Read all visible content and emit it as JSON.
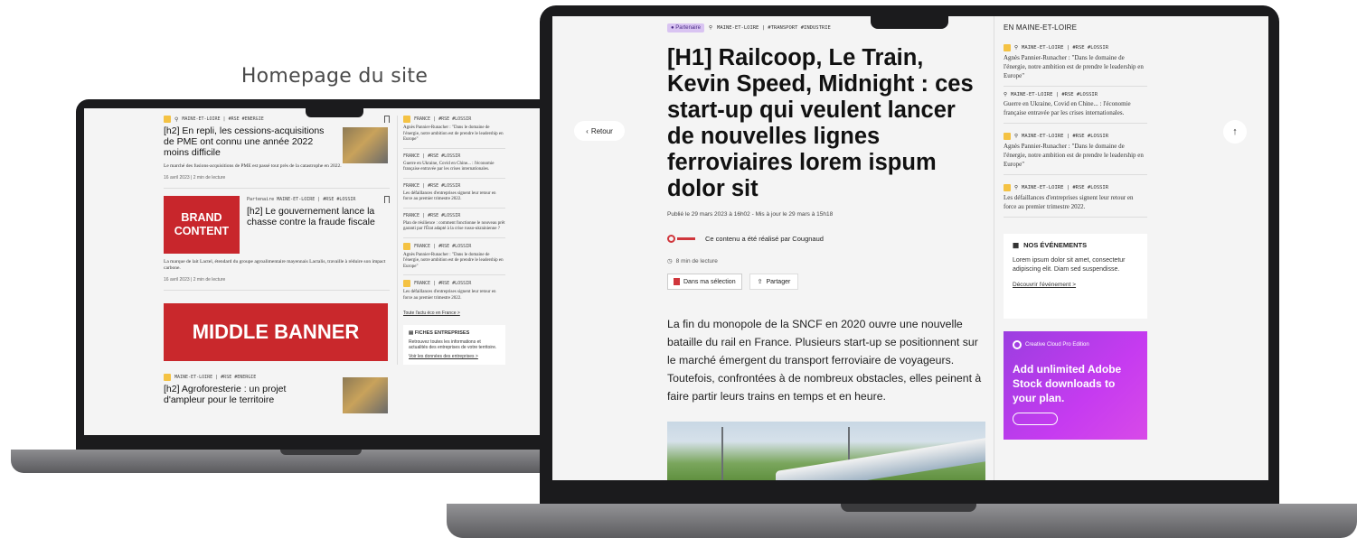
{
  "caption": "Homepage du site",
  "left": {
    "article1": {
      "tags": "MAINE-ET-LOIRE | #RSE #ENERGIE",
      "title": "[h2] En repli, les cessions-acquisitions de PME ont connu une année 2022 moins difficile",
      "excerpt": "Le marché des fusions-acquisitions de PME est passé tout près de la catastrophe en 2022.",
      "meta": "16 avril 2023 | 2 min de lecture"
    },
    "article2": {
      "tags": "Partenaire  MAINE-ET-LOIRE | #RSE #LOSSIR",
      "brand": "BRAND CONTENT",
      "title": "[h2] Le gouvernement lance la chasse contre la fraude fiscale",
      "excerpt": "La marque de lait Lactel, étendard du groupe agroalimentaire mayennais Lactalis, travaille à réduire son impact carbone.",
      "meta": "16 avril 2023 | 2 min de lecture"
    },
    "banner": "MIDDLE BANNER",
    "article3": {
      "tags": "MAINE-ET-LOIRE | #RSE #ENERGIE",
      "title": "[h2] Agroforesterie : un projet d'ampleur pour le territoire"
    },
    "side": {
      "items": [
        {
          "tag": "FRANCE | #RSE #LOSSIR",
          "text": "Agnès Pannier-Runacher : \"Dans le domaine de l'énergie, notre ambition est de prendre le leadership en Europe\""
        },
        {
          "tag": "FRANCE | #RSE #LOSSIR",
          "text": "Guerre en Ukraine, Covid en Chine... : l'économie française entravée par les crises internationales."
        },
        {
          "tag": "FRANCE | #RSE #LOSSIR",
          "text": "Les défaillances d'entreprises signent leur retour en force au premier trimestre 2022."
        },
        {
          "tag": "FRANCE | #RSE #LOSSIR",
          "text": "Plan de résilience : comment fonctionne le nouveau prêt garanti par l'État adapté à la crise russo-ukrainienne ?"
        },
        {
          "tag": "FRANCE | #RSE #LOSSIR",
          "text": "Agnès Pannier-Runacher : \"Dans le domaine de l'énergie, notre ambition est de prendre le leadership en Europe\""
        },
        {
          "tag": "FRANCE | #RSE #LOSSIR",
          "text": "Les défaillances d'entreprises signent leur retour en force au premier trimestre 2022."
        }
      ],
      "all_link": "Toute l'actu éco en France >",
      "fiche_title": "FICHES ENTREPRISES",
      "fiche_text": "Retrouvez toutes les informations et actualités des entreprises de votre territoire.",
      "fiche_link": "Voir les données des entreprises >"
    }
  },
  "right": {
    "back": "Retour",
    "up": "↑",
    "partner": "Partenaire",
    "tags": "MAINE-ET-LOIRE | #TRANSPORT #INDUSTRIE",
    "h1": "[H1] Railcoop, Le Train, Kevin Speed, Midnight : ces start-up qui veulent lancer de nouvelles lignes ferroviaires lorem ispum dolor sit",
    "date": "Publié le 29 mars 2023 à 16h02 - Mis à jour le 29 mars à 15h18",
    "brand_line": "Ce contenu a été réalisé par Cougnaud",
    "read": "8 min de lecture",
    "btn_selection": "Dans ma sélection",
    "btn_share": "Partager",
    "lead": "La fin du monopole de la SNCF en 2020 ouvre une nouvelle bataille du rail en France. Plusieurs start-up se positionnent sur le marché émergent du transport ferroviaire de voyageurs. Toutefois, confrontées à de nombreux obstacles, elles peinent à faire partir leurs trains en temps et en heure.",
    "side": {
      "title": "EN MAINE-ET-LOIRE",
      "items": [
        {
          "tag": "MAINE-ET-LOIRE | #RSE #LOSSIR",
          "text": "Agnès Pannier-Runacher : \"Dans le domaine de l'énergie, notre ambition est de prendre le leadership en Europe\""
        },
        {
          "tag": "MAINE-ET-LOIRE | #RSE #LOSSIR",
          "text": "Guerre en Ukraine, Covid en Chine... : l'économie française entravée par les crises internationales."
        },
        {
          "tag": "MAINE-ET-LOIRE | #RSE #LOSSIR",
          "text": "Agnès Pannier-Runacher : \"Dans le domaine de l'énergie, notre ambition est de prendre le leadership en Europe\""
        },
        {
          "tag": "MAINE-ET-LOIRE | #RSE #LOSSIR",
          "text": "Les défaillances d'entreprises signent leur retour en force au premier trimestre 2022."
        }
      ],
      "events_title": "NOS ÉVÉNEMENTS",
      "events_text": "Lorem ipsum dolor sit amet, consectetur adipiscing elit. Diam sed suspendisse.",
      "events_link": "Découvrir l'événement >",
      "ad_header": "Creative Cloud Pro Edition",
      "ad_body": "Add unlimited Adobe Stock downloads to your plan."
    }
  }
}
